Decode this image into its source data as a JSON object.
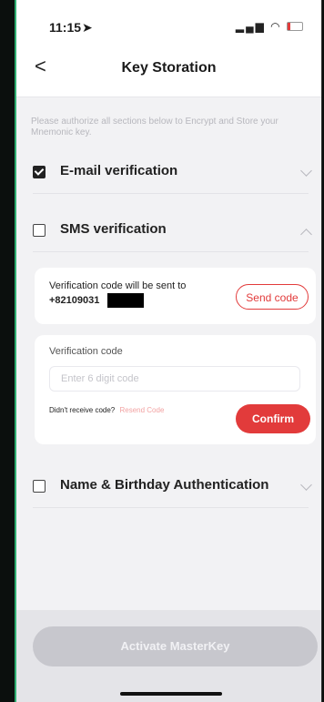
{
  "status_bar": {
    "time": "11:15",
    "icons": "signal wifi battery"
  },
  "nav": {
    "back_glyph": "<",
    "title": "Key Storation"
  },
  "instruction": "Please authorize all sections below to Encrypt and Store your Mnemonic key.",
  "sections": [
    {
      "label": "E-mail verification",
      "checked": true,
      "expanded": false
    },
    {
      "label": "SMS verification",
      "checked": false,
      "expanded": true
    },
    {
      "label": "Name & Birthday Authentication",
      "checked": false,
      "expanded": false
    }
  ],
  "sms": {
    "sent_text": "Verification code will be sent to",
    "phone_number": "+82109031",
    "send_code_label": "Send code",
    "code_label": "Verification code",
    "code_placeholder": "Enter 6 digit code",
    "no_receive_text": "Didn't receive code?",
    "resend_label": "Resend Code",
    "confirm_label": "Confirm"
  },
  "footer": {
    "activate_label": "Activate MasterKey"
  },
  "colors": {
    "accent_red": "#e23b3b",
    "disabled_gray": "#c7c7cd",
    "frame_green": "#2fae72"
  }
}
